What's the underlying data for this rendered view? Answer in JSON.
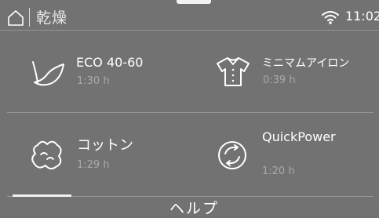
{
  "header": {
    "title": "乾燥",
    "time": "11:02",
    "icons": [
      "home-icon",
      "wifi-icon"
    ]
  },
  "programs": [
    {
      "name": "ECO 40-60",
      "duration": "1:30 h",
      "icon": "leaf-icon"
    },
    {
      "name": "ミニマムアイロン",
      "duration": "0:39 h",
      "icon": "shirt-icon"
    },
    {
      "name": "コットン",
      "duration": "1:29 h",
      "icon": "cotton-icon"
    },
    {
      "name": "QuickPower",
      "duration": "1:20 h",
      "icon": "quickpower-icon"
    }
  ],
  "footer": {
    "help_label": "ヘルプ"
  },
  "colors": {
    "background": "#727272",
    "text": "#ffffff",
    "secondary_text": "#a9a9a9",
    "divider": "#959595"
  }
}
